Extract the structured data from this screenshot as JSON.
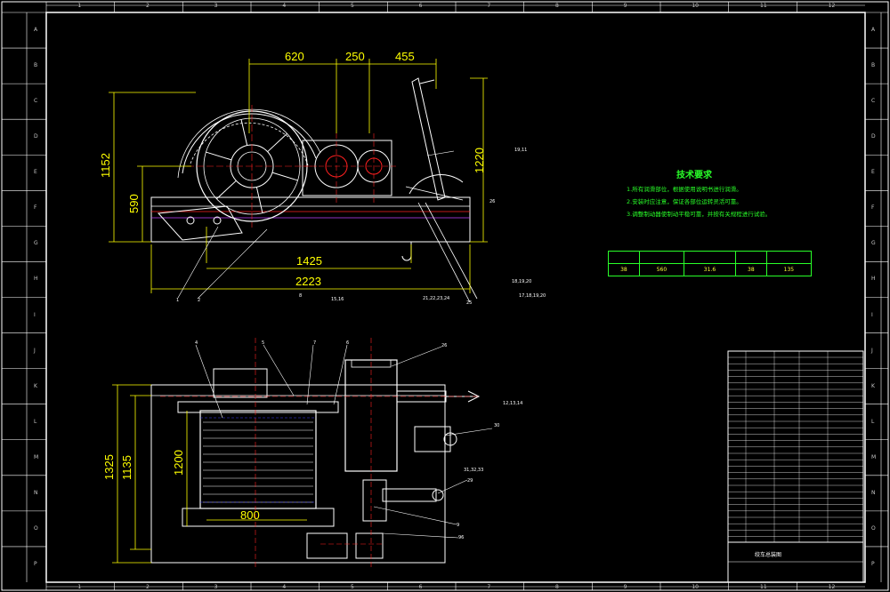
{
  "colors": {
    "background": "#000000",
    "frame": "#ffffff",
    "dimension": "#ffff00",
    "part": "#ffffff",
    "center_line": "#ff2020",
    "leader": "#ffffff",
    "notes": "#29ff29",
    "hidden": "#4040ff"
  },
  "dimensions": {
    "top_620": "620",
    "top_250": "250",
    "top_455": "455",
    "left_1152": "1152",
    "left_590": "590",
    "right_1220": "1220",
    "bottom_1425": "1425",
    "bottom_2223": "2223",
    "plan_1325": "1325",
    "plan_1135": "1135",
    "plan_1200": "1200",
    "plan_800": "800"
  },
  "technical_requirements": {
    "title": "技术要求",
    "notes": [
      "1.所有润滑部位，根据使用说明书进行润滑。",
      "2.安装时应注意，保证各部位运转灵活可靠。",
      "3.调整制动器使制动平稳可靠，并按有关规程进行试验。"
    ]
  },
  "spec_table": {
    "headers": [
      "",
      "",
      "",
      "",
      ""
    ],
    "values": [
      "38",
      "560",
      "31.6",
      "38",
      "135"
    ]
  },
  "balloons": {
    "b1": "1",
    "b2": "2",
    "b3": "4",
    "b4": "5",
    "b5": "7",
    "b6": "6",
    "b7": "26",
    "b8": "30",
    "b9": "29",
    "b10": "9",
    "b11": "96",
    "b12": "19,11",
    "b13": "18,19,20",
    "b14": "21,22,23,24",
    "b15": "25",
    "b16": "26",
    "b17": "17,18,19,20",
    "b18": "15,16",
    "b19": "31,32,33",
    "b20": "12,13,14",
    "b21": "8"
  },
  "zones": {
    "top": [
      "1",
      "2",
      "3",
      "4",
      "5",
      "6",
      "7",
      "8",
      "9",
      "10",
      "11",
      "12"
    ],
    "side": [
      "A",
      "B",
      "C",
      "D",
      "E",
      "F",
      "G",
      "H",
      "I",
      "J",
      "K",
      "L",
      "M",
      "N",
      "O",
      "P"
    ]
  },
  "title_block": {
    "drawing_name": "绞车总装图"
  }
}
